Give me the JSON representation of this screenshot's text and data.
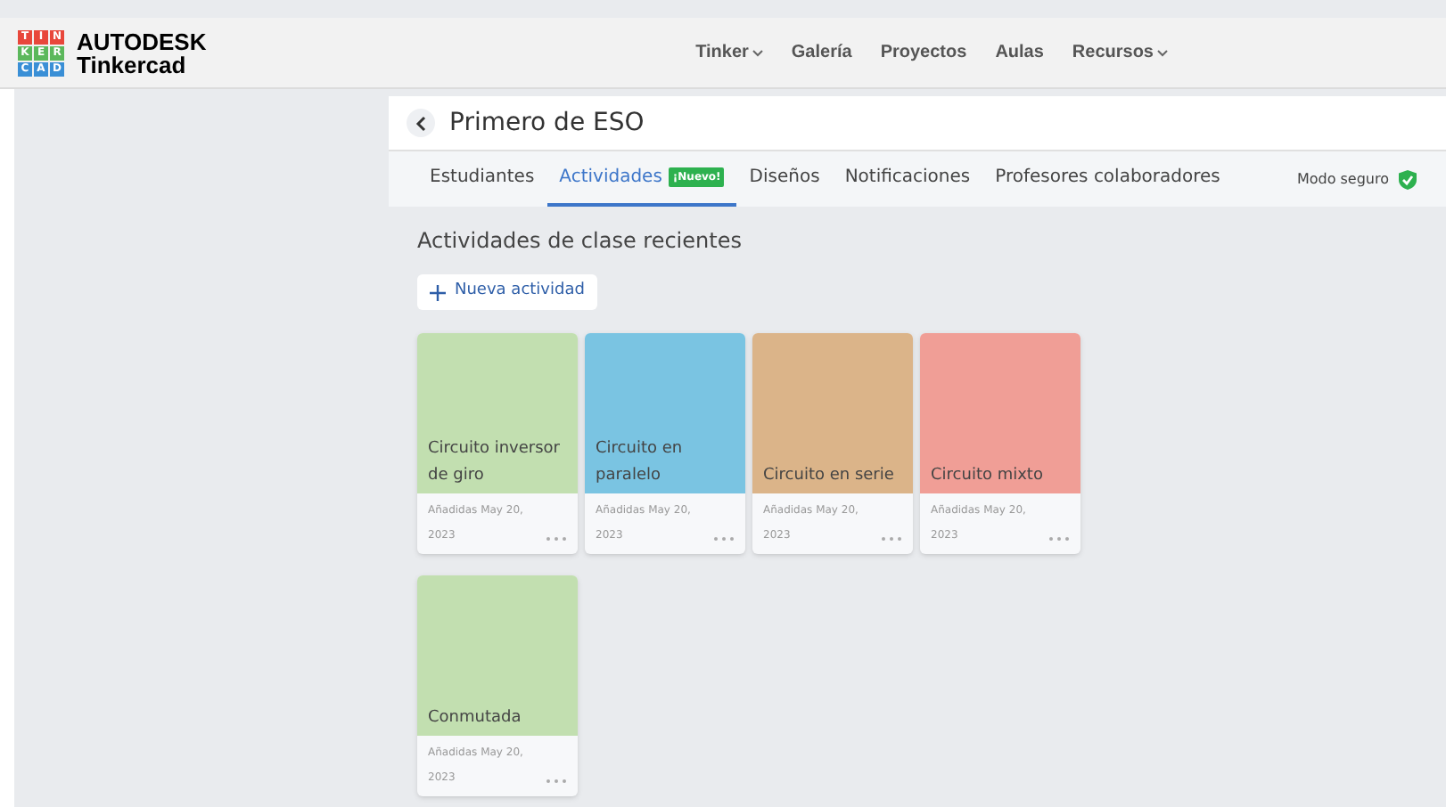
{
  "header": {
    "brand": "AUTODESK",
    "product": "Tinkercad",
    "logo_letters": [
      "T",
      "I",
      "N",
      "K",
      "E",
      "R",
      "C",
      "A",
      "D"
    ],
    "nav": [
      {
        "label": "Tinker",
        "dropdown": true
      },
      {
        "label": "Galería",
        "dropdown": false
      },
      {
        "label": "Proyectos",
        "dropdown": false
      },
      {
        "label": "Aulas",
        "dropdown": false
      },
      {
        "label": "Recursos",
        "dropdown": true
      }
    ]
  },
  "class_title": "Primero de ESO",
  "tabs": [
    {
      "label": "Estudiantes",
      "selected": false
    },
    {
      "label": "Actividades",
      "selected": true,
      "badge": "¡Nuevo!"
    },
    {
      "label": "Diseños",
      "selected": false
    },
    {
      "label": "Notificaciones",
      "selected": false
    },
    {
      "label": "Profesores colaboradores",
      "selected": false
    }
  ],
  "safe_mode": "Modo seguro",
  "section_title": "Actividades de clase recientes",
  "new_button": "Nueva actividad",
  "activities": [
    {
      "title": "Circuito inversor de giro",
      "color": "#c2dfb0",
      "added": "Añadidas May 20, 2023"
    },
    {
      "title": "Circuito en paralelo",
      "color": "#7ac4e2",
      "added": "Añadidas May 20, 2023"
    },
    {
      "title": "Circuito en serie",
      "color": "#dbb489",
      "added": "Añadidas May 20, 2023"
    },
    {
      "title": "Circuito mixto",
      "color": "#f09e96",
      "added": "Añadidas May 20, 2023"
    },
    {
      "title": "Conmutada",
      "color": "#c2dfb0",
      "added": "Añadidas May 20, 2023"
    }
  ]
}
